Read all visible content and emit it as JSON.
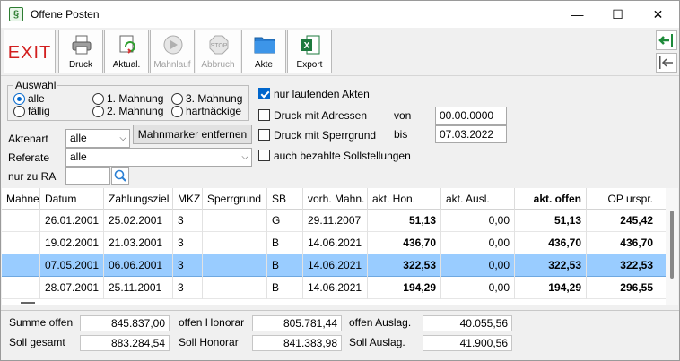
{
  "window": {
    "title": "Offene Posten",
    "minimize": "—",
    "maximize": "☐",
    "close": "✕"
  },
  "toolbar": {
    "exit": "EXIT",
    "buttons": [
      {
        "label": "Druck"
      },
      {
        "label": "Aktual."
      },
      {
        "label": "Mahnlauf"
      },
      {
        "label": "Abbruch"
      },
      {
        "label": "Akte"
      },
      {
        "label": "Export"
      }
    ]
  },
  "filter": {
    "group_title": "Auswahl",
    "radios": {
      "alle": "alle",
      "faellig": "fällig",
      "m1": "1. Mahnung",
      "m2": "2. Mahnung",
      "m3": "3. Mahnung",
      "hart": "hartnäckige"
    },
    "selected_radio": "alle",
    "aktenart_label": "Aktenart",
    "aktenart_value": "alle",
    "mahnmarker_button": "Mahnmarker entfernen",
    "referate_label": "Referate",
    "referate_value": "alle",
    "nur_zu_ra_label": "nur zu RA",
    "nur_zu_ra_value": "",
    "cb_laufende": "nur laufenden Akten",
    "cb_laufende_checked": true,
    "cb_adressen": "Druck mit Adressen",
    "cb_sperrgrund": "Druck mit Sperrgrund",
    "cb_bezahlte": "auch bezahlte Sollstellungen",
    "von_label": "von",
    "von_value": "00.00.0000",
    "bis_label": "bis",
    "bis_value": "07.03.2022"
  },
  "table": {
    "columns": [
      "Mahnen",
      "Datum",
      "Zahlungsziel",
      "MKZ",
      "Sperrgrund",
      "SB",
      "vorh. Mahn.",
      "akt. Hon.",
      "akt. Ausl.",
      "akt. offen",
      "OP urspr."
    ],
    "rows": [
      [
        "",
        "26.01.2001",
        "25.02.2001",
        "3",
        "",
        "G",
        "29.11.2007",
        "51,13",
        "0,00",
        "51,13",
        "245,42"
      ],
      [
        "",
        "19.02.2001",
        "21.03.2001",
        "3",
        "",
        "B",
        "14.06.2021",
        "436,70",
        "0,00",
        "436,70",
        "436,70"
      ],
      [
        "",
        "07.05.2001",
        "06.06.2001",
        "3",
        "",
        "B",
        "14.06.2021",
        "322,53",
        "0,00",
        "322,53",
        "322,53"
      ],
      [
        "",
        "28.07.2001",
        "25.11.2001",
        "3",
        "",
        "B",
        "14.06.2021",
        "194,29",
        "0,00",
        "194,29",
        "296,55"
      ]
    ],
    "selected_row": 2
  },
  "footer": {
    "summe_offen_label": "Summe offen",
    "summe_offen": "845.837,00",
    "soll_gesamt_label": "Soll gesamt",
    "soll_gesamt": "883.284,54",
    "offen_honorar_label": "offen Honorar",
    "offen_honorar": "805.781,44",
    "soll_honorar_label": "Soll Honorar",
    "soll_honorar": "841.383,98",
    "offen_auslag_label": "offen Auslag.",
    "offen_auslag": "40.055,56",
    "soll_auslag_label": "Soll Auslag.",
    "soll_auslag": "41.900,56"
  },
  "colors": {
    "selected_row": "#99ccff",
    "exit_red": "#d21f1f",
    "accent": "#0066cc"
  }
}
